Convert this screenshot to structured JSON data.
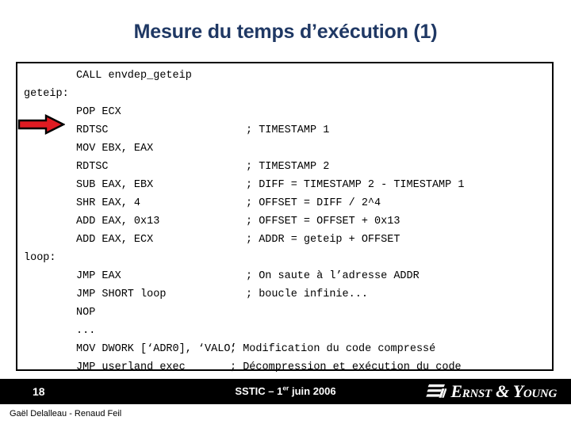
{
  "slide": {
    "title": "Mesure du temps d’exécution (1)",
    "title_color": "#1f3864"
  },
  "code_box": {
    "border_color": "#000000",
    "background": "#ffffff",
    "lines": [
      {
        "label": "",
        "instruction": "CALL envdep_geteip",
        "comment": ""
      },
      {
        "label": "geteip:",
        "instruction": "",
        "comment": ""
      },
      {
        "label": "",
        "instruction": "POP ECX",
        "comment": ""
      },
      {
        "label": "",
        "instruction": "RDTSC",
        "comment": "; TIMESTAMP 1"
      },
      {
        "label": "",
        "instruction": "MOV EBX, EAX",
        "comment": ""
      },
      {
        "label": "",
        "instruction": "RDTSC",
        "comment": "; TIMESTAMP 2"
      },
      {
        "label": "",
        "instruction": "SUB EAX, EBX",
        "comment": "; DIFF = TIMESTAMP 2 - TIMESTAMP 1"
      },
      {
        "label": "",
        "instruction": "SHR EAX, 4",
        "comment": "; OFFSET = DIFF / 2^4"
      },
      {
        "label": "",
        "instruction": "ADD EAX, 0x13",
        "comment": "; OFFSET = OFFSET + 0x13"
      },
      {
        "label": "",
        "instruction": "ADD EAX, ECX",
        "comment": "; ADDR = geteip + OFFSET"
      },
      {
        "label": "loop:",
        "instruction": "",
        "comment": ""
      },
      {
        "label": "",
        "instruction": "JMP EAX",
        "comment": "; On saute à l’adresse ADDR"
      },
      {
        "label": "",
        "instruction": "JMP SHORT loop",
        "comment": "; boucle infinie..."
      },
      {
        "label": "",
        "instruction": "NOP",
        "comment": ""
      },
      {
        "label": "",
        "instruction": "...",
        "comment": ""
      },
      {
        "label": "",
        "instruction": "MOV DWORK [‘ADR0], ‘VALO’",
        "comment": "; Modification du code compressé"
      },
      {
        "label": "",
        "instruction": "JMP userland_exec",
        "comment": "; Décompression et exécution du code"
      }
    ]
  },
  "arrow": {
    "name": "red-arrow",
    "fill": "#e01b22",
    "stroke": "#000000",
    "points_at_line": "RDTSC"
  },
  "footer": {
    "background": "#000000",
    "page_number": "18",
    "event_prefix": "SSTIC – 1",
    "event_superscript": "er",
    "event_suffix": " juin 2006",
    "logo_text": "Ernst & Young",
    "logo_mark": "ey-bars-icon"
  },
  "authors": "Gaël Delalleau - Renaud Feil"
}
